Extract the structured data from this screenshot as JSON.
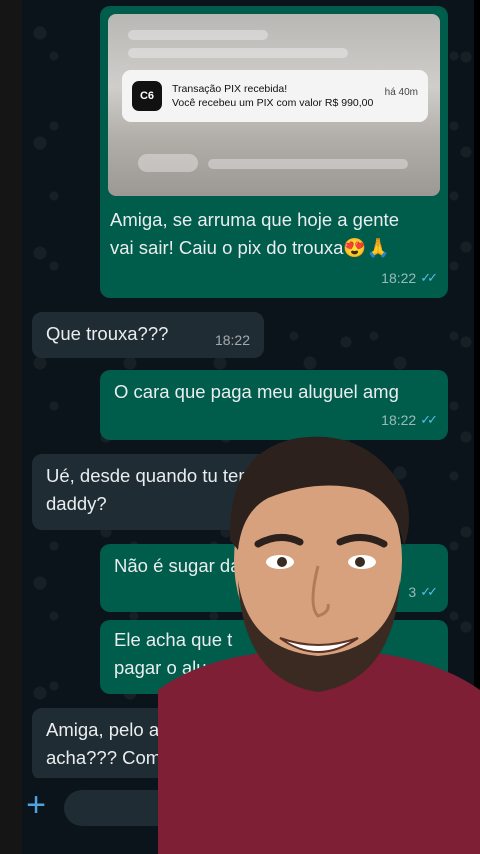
{
  "chat": {
    "messages": [
      {
        "dir": "out",
        "text_l1": "Amiga, se arruma que hoje a gente",
        "text_l2": "vai sair! Caiu o pix do trouxa😍🙏",
        "time": "18:22"
      },
      {
        "dir": "in",
        "text": "Que trouxa???",
        "time": "18:22"
      },
      {
        "dir": "out",
        "text": "O cara que paga meu aluguel amg",
        "time": "18:22"
      },
      {
        "dir": "in",
        "text_l1": "Ué, desde quando tu tem",
        "text_l2": "daddy?"
      },
      {
        "dir": "out",
        "text": "Não é sugar da",
        "time": "3"
      },
      {
        "dir": "out",
        "text_l1": "Ele acha que t",
        "text_l2": "pagar o alu"
      },
      {
        "dir": "in",
        "text_l1": "Amiga, pelo a",
        "text_l2": "acha??? Com"
      }
    ]
  },
  "notification": {
    "logo": "C6",
    "title": "Transação PIX recebida!",
    "body": "Você recebeu um PIX com valor R$ 990,00",
    "time": "há 40m"
  },
  "input": {
    "plus_label": "+"
  },
  "icons": {
    "ticks": "double-check-icon",
    "plus": "plus-icon"
  },
  "colors": {
    "outgoing": "#005c4b",
    "incoming": "#202c33",
    "ticks": "#53bdeb",
    "background": "#0b141a"
  }
}
